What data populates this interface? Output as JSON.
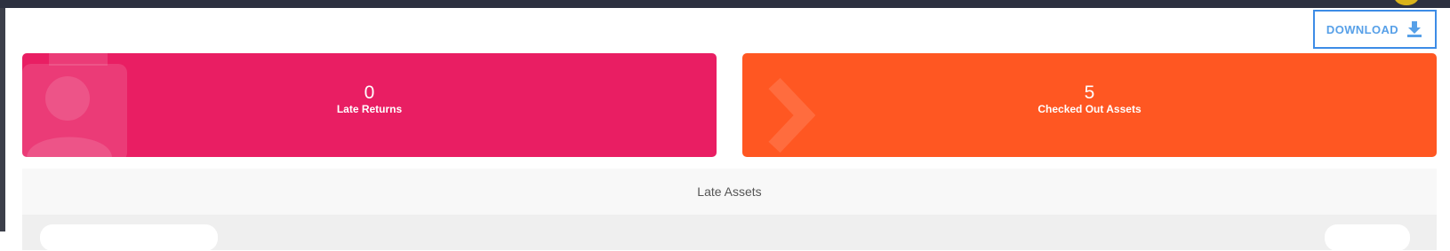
{
  "toolbar": {
    "download_label": "DOWNLOAD",
    "download_icon": "download-icon"
  },
  "stats": [
    {
      "count": "0",
      "label": "Late Returns",
      "color": "#e91e63",
      "icon": "badge-person-icon"
    },
    {
      "count": "5",
      "label": "Checked Out Assets",
      "color": "#ff5722",
      "icon": "chevron-right-icon"
    }
  ],
  "late_assets_panel": {
    "title": "Late Assets"
  },
  "colors": {
    "topbar": "#2d3140",
    "accent": "#3d8ce6",
    "pink": "#e91e63",
    "orange": "#ff5722"
  }
}
